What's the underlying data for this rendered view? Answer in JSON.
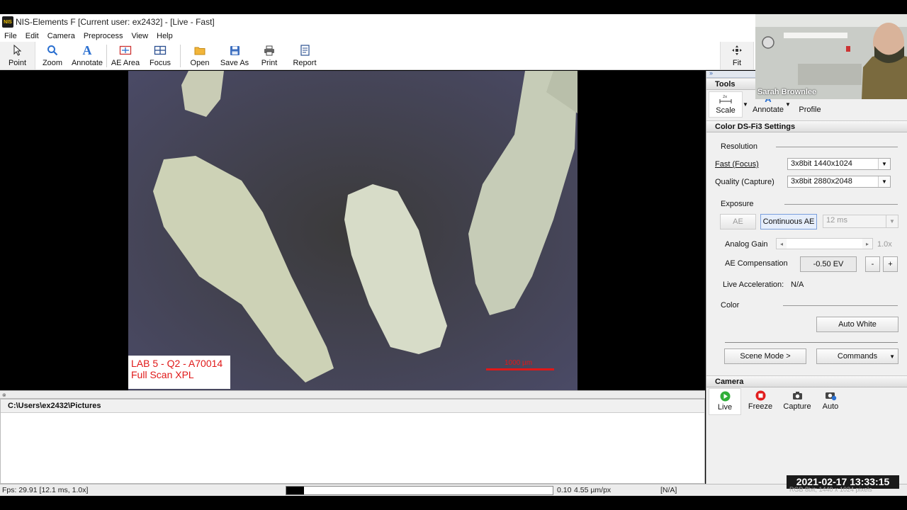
{
  "window": {
    "title": "NIS-Elements F [Current user: ex2432] - [Live - Fast]",
    "icon_text": "NIS"
  },
  "menu": [
    "File",
    "Edit",
    "Camera",
    "Preprocess",
    "View",
    "Help"
  ],
  "toolbar": {
    "point": "Point",
    "zoom": "Zoom",
    "annotate": "Annotate",
    "ae_area": "AE Area",
    "focus": "Focus",
    "open": "Open",
    "save_as": "Save As",
    "print": "Print",
    "report": "Report",
    "fit": "Fit"
  },
  "image": {
    "label_line1": "LAB 5 - Q2 - A70014",
    "label_line2": "Full Scan XPL",
    "scale_text": "1000 µm"
  },
  "browser": {
    "path": "C:\\Users\\ex2432\\Pictures"
  },
  "status": {
    "fps": "Fps: 29.91 [12.1 ms, 1.0x]",
    "zoom": "0.10",
    "pixel_size": "4.55 µm/px",
    "na": "[N/A]",
    "image_info": "RGB 8bit; 1440 x 1024 pixels"
  },
  "tools_panel": {
    "title": "Tools",
    "scale": "Scale",
    "scale_badge": "2x",
    "annotate": "Annotate",
    "profile": "Profile"
  },
  "settings": {
    "title": "Color DS-Fi3 Settings",
    "resolution": "Resolution",
    "fast_label": "Fast (Focus)",
    "fast_value": "3x8bit 1440x1024",
    "quality_label": "Quality (Capture)",
    "quality_value": "3x8bit 2880x2048",
    "exposure": "Exposure",
    "ae_button": "AE",
    "continuous_ae": "Continuous AE",
    "exposure_value": "12 ms",
    "analog_gain": "Analog Gain",
    "gain_value": "1.0x",
    "ae_compensation": "AE Compensation",
    "ae_comp_value": "-0.50 EV",
    "minus": "-",
    "plus": "+",
    "live_accel_label": "Live Acceleration:",
    "live_accel_value": "N/A",
    "color": "Color",
    "auto_white": "Auto White",
    "scene_mode": "Scene Mode >",
    "commands": "Commands"
  },
  "camera_panel": {
    "title": "Camera",
    "live": "Live",
    "freeze": "Freeze",
    "capture": "Capture",
    "auto": "Auto"
  },
  "overlay": {
    "participant": "Sarah Brownlee",
    "timestamp": "2021-02-17  13:33:15"
  }
}
